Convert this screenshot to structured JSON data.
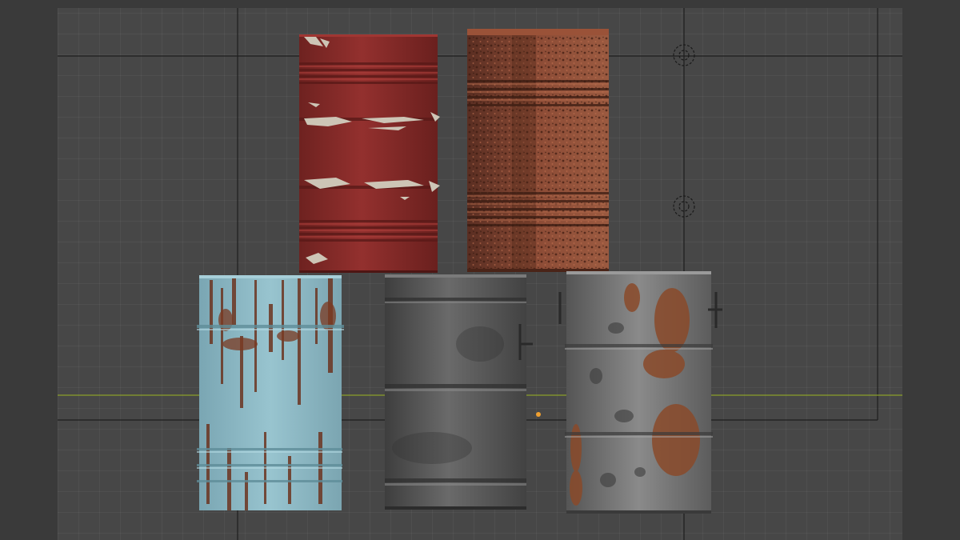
{
  "app": {
    "name": "3D viewport"
  },
  "viewport": {
    "background": "#3a3a3a",
    "panel_color": "#474747",
    "grid_color": "#525252",
    "horizon_axis_color": "#8aa02a",
    "camera_frame_color": "#1e1e1e",
    "origin_marker_color": "#f0a030"
  },
  "objects": [
    {
      "name": "red-barrel",
      "base_color": "#8e2e2c",
      "wear_color": "#c9c2b3"
    },
    {
      "name": "rusty-barrel",
      "base_color": "#8a4a34",
      "wear_color": "#5a2c1e"
    },
    {
      "name": "light-blue-barrel",
      "base_color": "#8db8c4",
      "wear_color": "#6c3420"
    },
    {
      "name": "dark-gray-barrel",
      "base_color": "#5d5d5d",
      "wear_color": "#3e3e3e"
    },
    {
      "name": "rusted-gray-barrel",
      "base_color": "#747474",
      "wear_color": "#8a4a2a"
    }
  ],
  "gizmos": [
    {
      "name": "light-gizmo-top",
      "icon": "light-icon"
    },
    {
      "name": "light-gizmo-middle",
      "icon": "light-icon"
    }
  ]
}
